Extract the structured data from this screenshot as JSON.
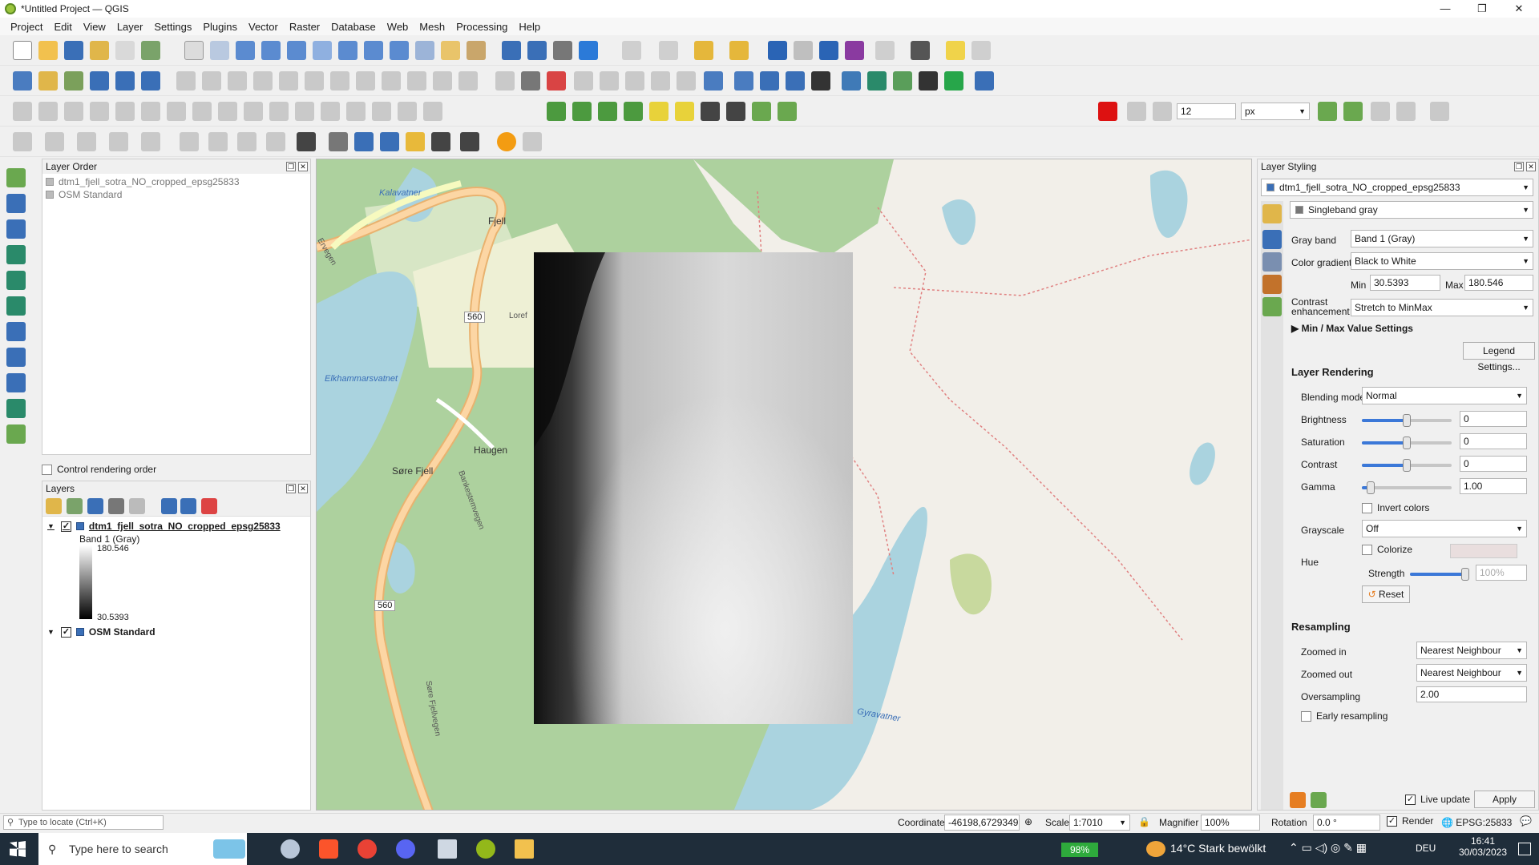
{
  "window": {
    "title": "*Untitled Project — QGIS",
    "minimize": "—",
    "maximize": "❐",
    "close": "✕"
  },
  "menu": [
    "Project",
    "Edit",
    "View",
    "Layer",
    "Settings",
    "Plugins",
    "Vector",
    "Raster",
    "Database",
    "Web",
    "Mesh",
    "Processing",
    "Help"
  ],
  "toolbar4": {
    "size_value": "12",
    "unit": "px"
  },
  "layer_order": {
    "title": "Layer Order",
    "items": [
      "dtm1_fjell_sotra_NO_cropped_epsg25833",
      "OSM Standard"
    ],
    "control_label": "Control rendering order"
  },
  "layers": {
    "title": "Layers",
    "raster": {
      "name": "dtm1_fjell_sotra_NO_cropped_epsg25833",
      "band": "Band 1 (Gray)",
      "max": "180.546",
      "min": "30.5393"
    },
    "osm": {
      "name": "OSM Standard"
    }
  },
  "map": {
    "labels": [
      "Kalavatner",
      "Fjell",
      "Elkhammarsvatnet",
      "Haugen",
      "Søre Fjell",
      "Bankestemvegen",
      "560",
      "560",
      "Gyravatner",
      "Søre Fjellvegen",
      "Ervegen",
      "Loref"
    ]
  },
  "styling": {
    "title": "Layer Styling",
    "layer": "dtm1_fjell_sotra_NO_cropped_epsg25833",
    "renderer": "Singleband gray",
    "gray_band_label": "Gray band",
    "gray_band": "Band 1 (Gray)",
    "gradient_label": "Color gradient",
    "gradient": "Black to White",
    "min_label": "Min",
    "min": "30.5393",
    "max_label": "Max",
    "max": "180.546",
    "contrast_label": "Contrast enhancement",
    "contrast": "Stretch to MinMax",
    "minmax_settings": "Min / Max Value Settings",
    "legend_settings": "Legend Settings...",
    "rendering_title": "Layer Rendering",
    "blending_label": "Blending mode",
    "blending": "Normal",
    "brightness_label": "Brightness",
    "brightness": "0",
    "brightness_level": 0.5,
    "saturation_label": "Saturation",
    "saturation": "0",
    "saturation_level": 0.5,
    "contrast2_label": "Contrast",
    "contrast2": "0",
    "contrast2_level": 0.5,
    "gamma_label": "Gamma",
    "gamma": "1.00",
    "gamma_level": 0.1,
    "invert_label": "Invert colors",
    "grayscale_label": "Grayscale",
    "grayscale": "Off",
    "colorize_label": "Colorize",
    "hue_label": "Hue",
    "strength_label": "Strength",
    "strength": "100%",
    "strength_level": 1.0,
    "reset": "Reset",
    "resampling_title": "Resampling",
    "zoomed_in_label": "Zoomed in",
    "zoomed_in": "Nearest Neighbour",
    "zoomed_out_label": "Zoomed out",
    "zoomed_out": "Nearest Neighbour",
    "oversampling_label": "Oversampling",
    "oversampling": "2.00",
    "early_label": "Early resampling",
    "live_update": "Live update",
    "apply": "Apply"
  },
  "status": {
    "locate_placeholder": "Type to locate (Ctrl+K)",
    "coord_label": "Coordinate",
    "coord": "-46198,6729349",
    "scale_label": "Scale",
    "scale": "1:7010",
    "magnifier_label": "Magnifier",
    "magnifier": "100%",
    "rotation_label": "Rotation",
    "rotation": "0.0 °",
    "render_label": "Render",
    "crs": "EPSG:25833"
  },
  "taskbar": {
    "search": "Type here to search",
    "battery": "98%",
    "weather": "14°C  Stark bewölkt",
    "lang": "DEU",
    "time": "16:41",
    "date": "30/03/2023"
  }
}
